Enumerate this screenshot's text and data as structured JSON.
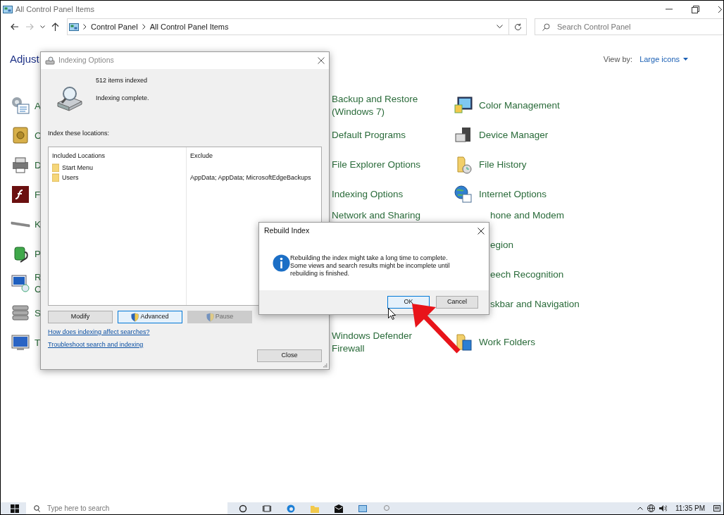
{
  "window": {
    "title": "All Control Panel Items"
  },
  "address": {
    "crumbs": [
      "Control Panel",
      "All Control Panel Items"
    ]
  },
  "search": {
    "placeholder": "Search Control Panel"
  },
  "header": {
    "title": "Adjust",
    "view_by_label": "View by:",
    "view_by_value": "Large icons"
  },
  "left_column": [
    {
      "label": "A"
    },
    {
      "label": "C"
    },
    {
      "label": "D"
    },
    {
      "label": "F"
    },
    {
      "label": "K"
    },
    {
      "label": "P"
    },
    {
      "label": "R C"
    },
    {
      "label": "S"
    },
    {
      "label": "T"
    }
  ],
  "middle_column": {
    "top": [
      {
        "label": "Backup and Restore (Windows 7)",
        "covered": false
      },
      {
        "label": "Default Programs",
        "covered": false
      },
      {
        "label": "File Explorer Options",
        "covered": false
      },
      {
        "label": "Indexing Options",
        "covered": false
      },
      {
        "label": "Network and Sharing",
        "covered": true
      }
    ],
    "bottom": [
      {
        "label": "Windows Defender Firewall"
      }
    ]
  },
  "right_column": [
    {
      "label": "Color Management",
      "covered": false
    },
    {
      "label": "Device Manager",
      "covered": false
    },
    {
      "label": "File History",
      "covered": false
    },
    {
      "label": "Internet Options",
      "covered": false
    },
    {
      "label": "hone and Modem",
      "covered": true
    },
    {
      "label": "egion",
      "covered": true
    },
    {
      "label": "eech Recognition",
      "covered": true
    },
    {
      "label": "skbar and Navigation",
      "covered": true
    },
    {
      "label": "Work Folders",
      "covered": false
    }
  ],
  "indexing_dialog": {
    "title": "Indexing Options",
    "count": "512 items indexed",
    "status": "Indexing complete.",
    "locations_label": "Index these locations:",
    "columns": [
      "Included Locations",
      "Exclude"
    ],
    "locations": [
      {
        "name": "Start Menu"
      },
      {
        "name": "Users",
        "exclude": "AppData; AppData; MicrosoftEdgeBackups"
      }
    ],
    "buttons": [
      {
        "label": "Modify",
        "shield": false,
        "focused": false,
        "disabled": false
      },
      {
        "label": "Advanced",
        "shield": true,
        "focused": true,
        "disabled": false
      },
      {
        "label": "Pause",
        "shield": true,
        "focused": false,
        "disabled": true
      }
    ],
    "links": [
      "How does indexing affect searches?",
      "Troubleshoot search and indexing"
    ],
    "close_button": "Close"
  },
  "rebuild_dialog": {
    "title": "Rebuild Index",
    "message": "Rebuilding the index might take a long time to complete. Some views and search results might be incomplete until rebuilding is finished.",
    "buttons": [
      {
        "label": "OK",
        "focused": true
      },
      {
        "label": "Cancel",
        "focused": false
      }
    ]
  },
  "taskbar": {
    "search_placeholder": "Type here to search",
    "clock": "11:35 PM"
  }
}
